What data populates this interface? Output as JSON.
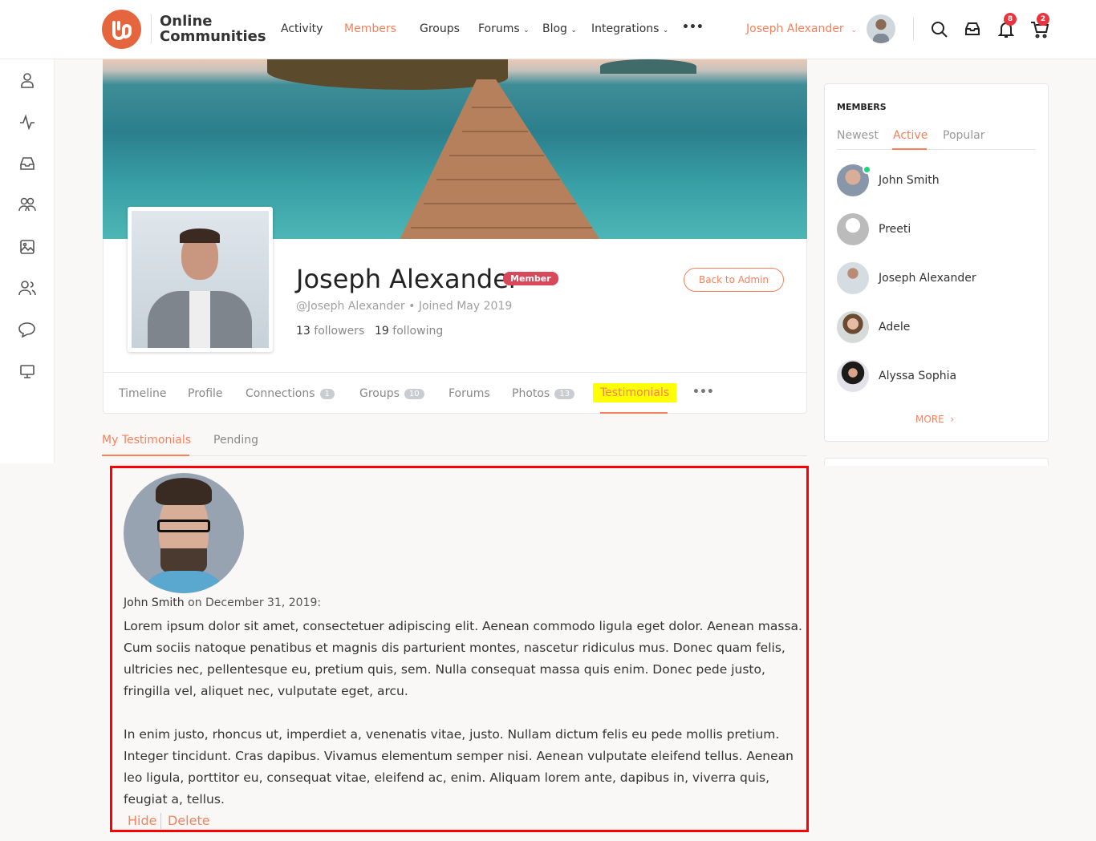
{
  "brand": {
    "name_line1": "Online",
    "name_line2": "Communities",
    "color": "#e5653e"
  },
  "nav": {
    "items": [
      {
        "label": "Activity"
      },
      {
        "label": "Members",
        "active": true
      },
      {
        "label": "Groups"
      },
      {
        "label": "Forums",
        "dropdown": true
      },
      {
        "label": "Blog",
        "dropdown": true
      },
      {
        "label": "Integrations",
        "dropdown": true
      }
    ],
    "more": "•••"
  },
  "user": {
    "name": "Joseph Alexander",
    "notifications": "8",
    "cart": "2"
  },
  "sidebar": {
    "icons": [
      "menu-icon",
      "profile-icon",
      "activity-icon",
      "inbox-icon",
      "groups-icon",
      "photos-icon",
      "connections-icon",
      "forums-icon",
      "monitor-icon"
    ]
  },
  "profile": {
    "name": "Joseph Alexander",
    "role_badge": "Member",
    "handle": "@Joseph Alexander",
    "joined": "Joined May 2019",
    "followers_count": "13",
    "followers_label": "followers",
    "following_count": "19",
    "following_label": "following",
    "back_button": "Back to Admin"
  },
  "tabs": [
    {
      "label": "Timeline"
    },
    {
      "label": "Profile"
    },
    {
      "label": "Connections",
      "count": "1"
    },
    {
      "label": "Groups",
      "count": "10"
    },
    {
      "label": "Forums"
    },
    {
      "label": "Photos",
      "count": "13"
    },
    {
      "label": "Testimonials",
      "active": true
    }
  ],
  "tabs_more": "•••",
  "subtabs": [
    {
      "label": "My Testimonials",
      "active": true
    },
    {
      "label": "Pending"
    }
  ],
  "testimonial": {
    "author": "John Smith",
    "date_text": "on December 31, 2019:",
    "paragraphs": [
      "Lorem ipsum dolor sit amet, consectetuer adipiscing elit. Aenean commodo ligula eget dolor. Aenean massa. Cum sociis natoque penatibus et magnis dis parturient montes, nascetur ridiculus mus. Donec quam felis, ultricies nec, pellentesque eu, pretium quis, sem. Nulla consequat massa quis enim. Donec pede justo, fringilla vel, aliquet nec, vulputate eget, arcu.",
      "In enim justo, rhoncus ut, imperdiet a, venenatis vitae, justo. Nullam dictum felis eu pede mollis pretium. Integer tincidunt. Cras dapibus. Vivamus elementum semper nisi. Aenean vulputate eleifend tellus. Aenean leo ligula, porttitor eu, consequat vitae, eleifend ac, enim. Aliquam lorem ante, dapibus in, viverra quis, feugiat a, tellus."
    ],
    "hide": "Hide",
    "delete": "Delete"
  },
  "members_widget": {
    "title": "MEMBERS",
    "tabs": [
      {
        "label": "Newest"
      },
      {
        "label": "Active",
        "active": true
      },
      {
        "label": "Popular"
      }
    ],
    "members": [
      {
        "name": "John Smith",
        "online": true
      },
      {
        "name": "Preeti"
      },
      {
        "name": "Joseph Alexander"
      },
      {
        "name": "Adele"
      },
      {
        "name": "Alyssa Sophia"
      }
    ],
    "more": "MORE"
  },
  "colors": {
    "accent": "#f7805a",
    "badge_red": "#e8343f",
    "member_badge": "#d9475a",
    "online": "#1fd47a",
    "highlight": "#ffff00",
    "border_red": "#ff0000"
  }
}
